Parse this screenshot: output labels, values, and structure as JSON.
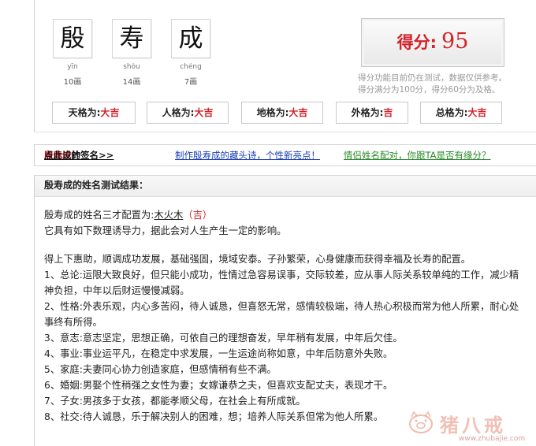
{
  "name_chars": [
    {
      "char": "殷",
      "pinyin": "yīn",
      "strokes": "10画"
    },
    {
      "char": "寿",
      "pinyin": "shòu",
      "strokes": "14画"
    },
    {
      "char": "成",
      "pinyin": "chéng",
      "strokes": "7画"
    }
  ],
  "score": {
    "label": "得分:",
    "value": "95",
    "note1": "得分功能目前仍在测试，数据仅供参考。",
    "note2": "得分满分为100分，得分60分为及格。"
  },
  "grades": [
    {
      "label": "天格为:",
      "value": "大吉"
    },
    {
      "label": "人格为:",
      "value": "大吉"
    },
    {
      "label": "地格为:",
      "value": "大吉"
    },
    {
      "label": "外格为:",
      "value": "吉"
    },
    {
      "label": "总格为:",
      "value": "大吉"
    }
  ],
  "links": {
    "design_prefix": "点此设计",
    "design_name": "殷寿成",
    "design_suffix": "的签名>>",
    "acrostic": "制作殷寿成的藏头诗，个性新亮点！",
    "pairing": "情侣姓名配对，你跟TA是否有缘分？"
  },
  "result": {
    "header": "殷寿成的姓名测试结果：",
    "sancai_prefix": "殷寿成的姓名三才配置为:",
    "sancai_value": "木火木",
    "sancai_grade": "（吉）",
    "sancai_line2": "它具有如下数理诱导力，据此会对人生产生一定的影响。",
    "summary": "得上下惠助，顺调成功发展，基础强固，境域安泰。子孙繁荣，心身健康而获得幸福及长寿的配置。",
    "items": [
      "1、总论:运限大致良好，但只能小成功，性情过急容易误事，交际较差，应从事人际关系较单纯的工作，减少精神负担，中年以后财运慢慢减弱。",
      "2、性格:外表乐观，内心多苦闷，待人诚恳，但喜怒无常，感情较极端，待人热心积极而常为他人所累，耐心处事终有所得。",
      "3、意志:意志坚定，思想正确，可依自己的理想奋发，早年稍有发展，中年后欠佳。",
      "4、事业:事业运平凡，在稳定中求发展，一生运途尚称如意，中年后防意外失败。",
      "5、家庭:夫妻同心协力创造家庭，但感情稍有些不满。",
      "6、婚姻:男娶个性稍强之女性为妻；女嫁谦恭之夫，但喜欢支配丈夫，表现才干。",
      "7、子女:男孩多于女孩，都能孝顺父母，在社会上有所成就。",
      "8、社交:待人诚恳，乐于解决别人的困难，想；培养人际关系但常为他人所累。"
    ]
  },
  "watermark": {
    "text": "猪八戒",
    "url": "www.zhubajie.com"
  },
  "colors": {
    "accent": "#d2232a",
    "link_blue": "#1a3fb3",
    "link_green": "#2a8a2a"
  }
}
